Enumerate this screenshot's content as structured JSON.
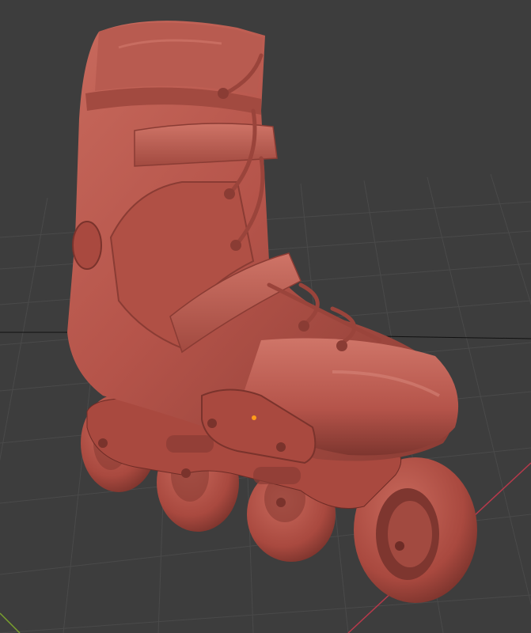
{
  "viewport": {
    "background": "#3d3d3d",
    "grid_color": "#4a4a4a",
    "x_axis_color": "#b8394b",
    "y_axis_color": "#7aa12e",
    "horizon_line_color": "#111111"
  },
  "model": {
    "object": "inline-skate-boot",
    "material_color": "#b5544a",
    "shadow_color": "#6e2c26",
    "highlight_color": "#d27a6d",
    "origin_marker_color": "#ff9c1a"
  }
}
